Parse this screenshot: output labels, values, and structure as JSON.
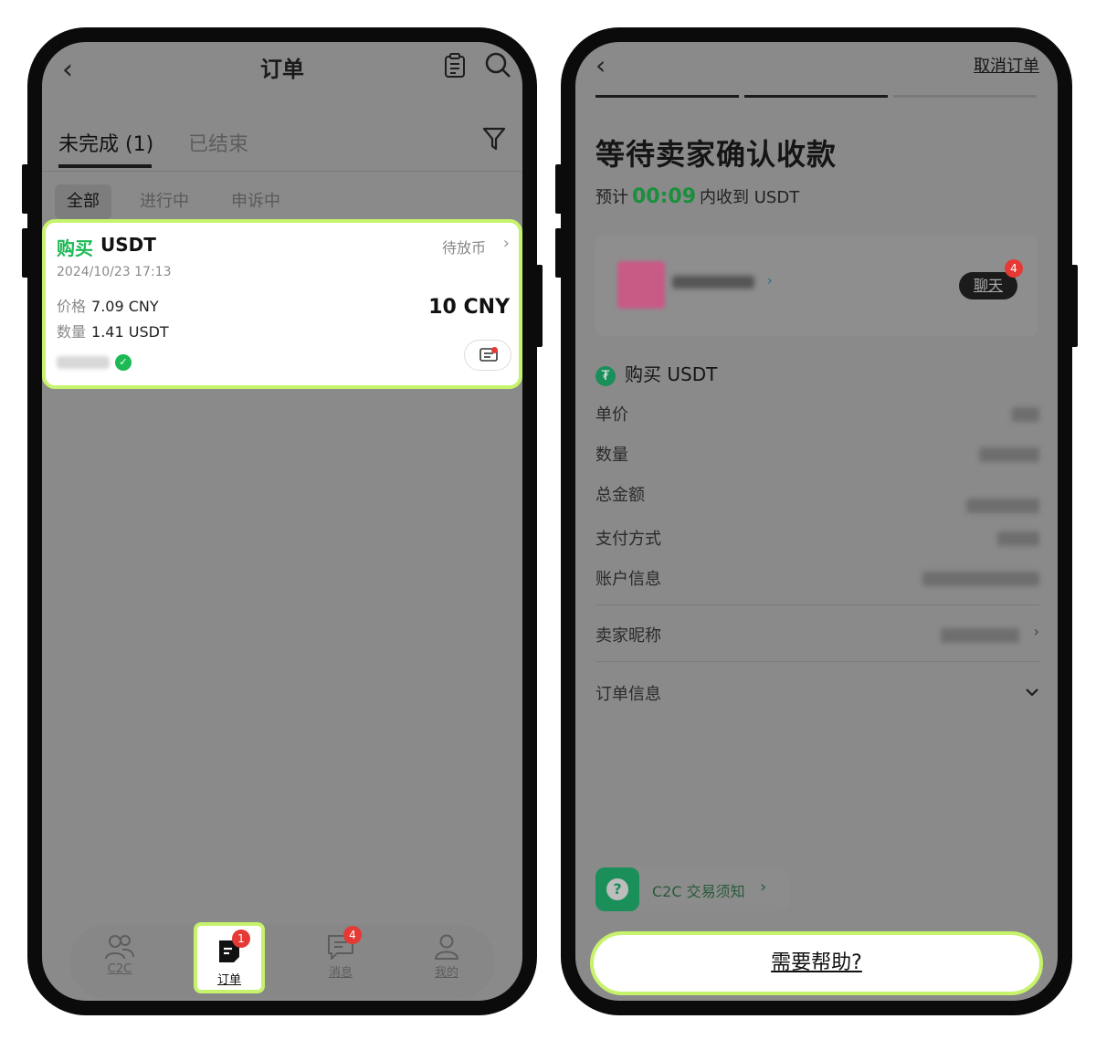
{
  "left": {
    "nav": {
      "title": "订单",
      "back_icon": "chevron-left-icon",
      "doc_icon": "clipboard-icon",
      "search_icon": "search-icon"
    },
    "tabs": [
      {
        "label": "未完成 (1)",
        "active": true
      },
      {
        "label": "已结束",
        "active": false
      }
    ],
    "filter_icon": "filter-icon",
    "subtabs": [
      {
        "label": "全部",
        "active": true
      },
      {
        "label": "进行中",
        "active": false
      },
      {
        "label": "申诉中",
        "active": false
      }
    ],
    "order": {
      "side": "购买",
      "coin": "USDT",
      "status": "待放币",
      "timestamp": "2024/10/23 17:13",
      "price_label": "价格",
      "price_value": "7.09 CNY",
      "qty_label": "数量",
      "qty_value": "1.41 USDT",
      "total": "10 CNY",
      "chat_icon": "chat-icon"
    },
    "bottom_nav": [
      {
        "label": "C2C",
        "icon": "users-icon",
        "active": false
      },
      {
        "label": "订单",
        "icon": "order-icon",
        "active": true,
        "badge": "1"
      },
      {
        "label": "消息",
        "icon": "message-icon",
        "active": false,
        "badge": "4"
      },
      {
        "label": "我的",
        "icon": "profile-icon",
        "active": false
      }
    ],
    "highlight_color": "#c6f36b",
    "buy_color": "#1db955"
  },
  "right": {
    "back_icon": "chevron-left-icon",
    "cancel_label": "取消订单",
    "heading": "等待卖家确认收款",
    "eta_prefix": "预计",
    "eta_timer": "00:09",
    "eta_suffix": "内收到 USDT",
    "chat_label": "聊天",
    "chat_badge": "4",
    "coin_row": "购买 USDT",
    "rows": [
      {
        "label": "单价"
      },
      {
        "label": "数量"
      },
      {
        "label": "总金额"
      },
      {
        "label": "支付方式"
      },
      {
        "label": "账户信息"
      },
      {
        "label": "卖家昵称"
      },
      {
        "label": "订单信息"
      }
    ],
    "notice": "C2C 交易须知",
    "help_button": "需要帮助?",
    "timer_color": "#1a8f3c",
    "highlight_color": "#c6f36b"
  }
}
